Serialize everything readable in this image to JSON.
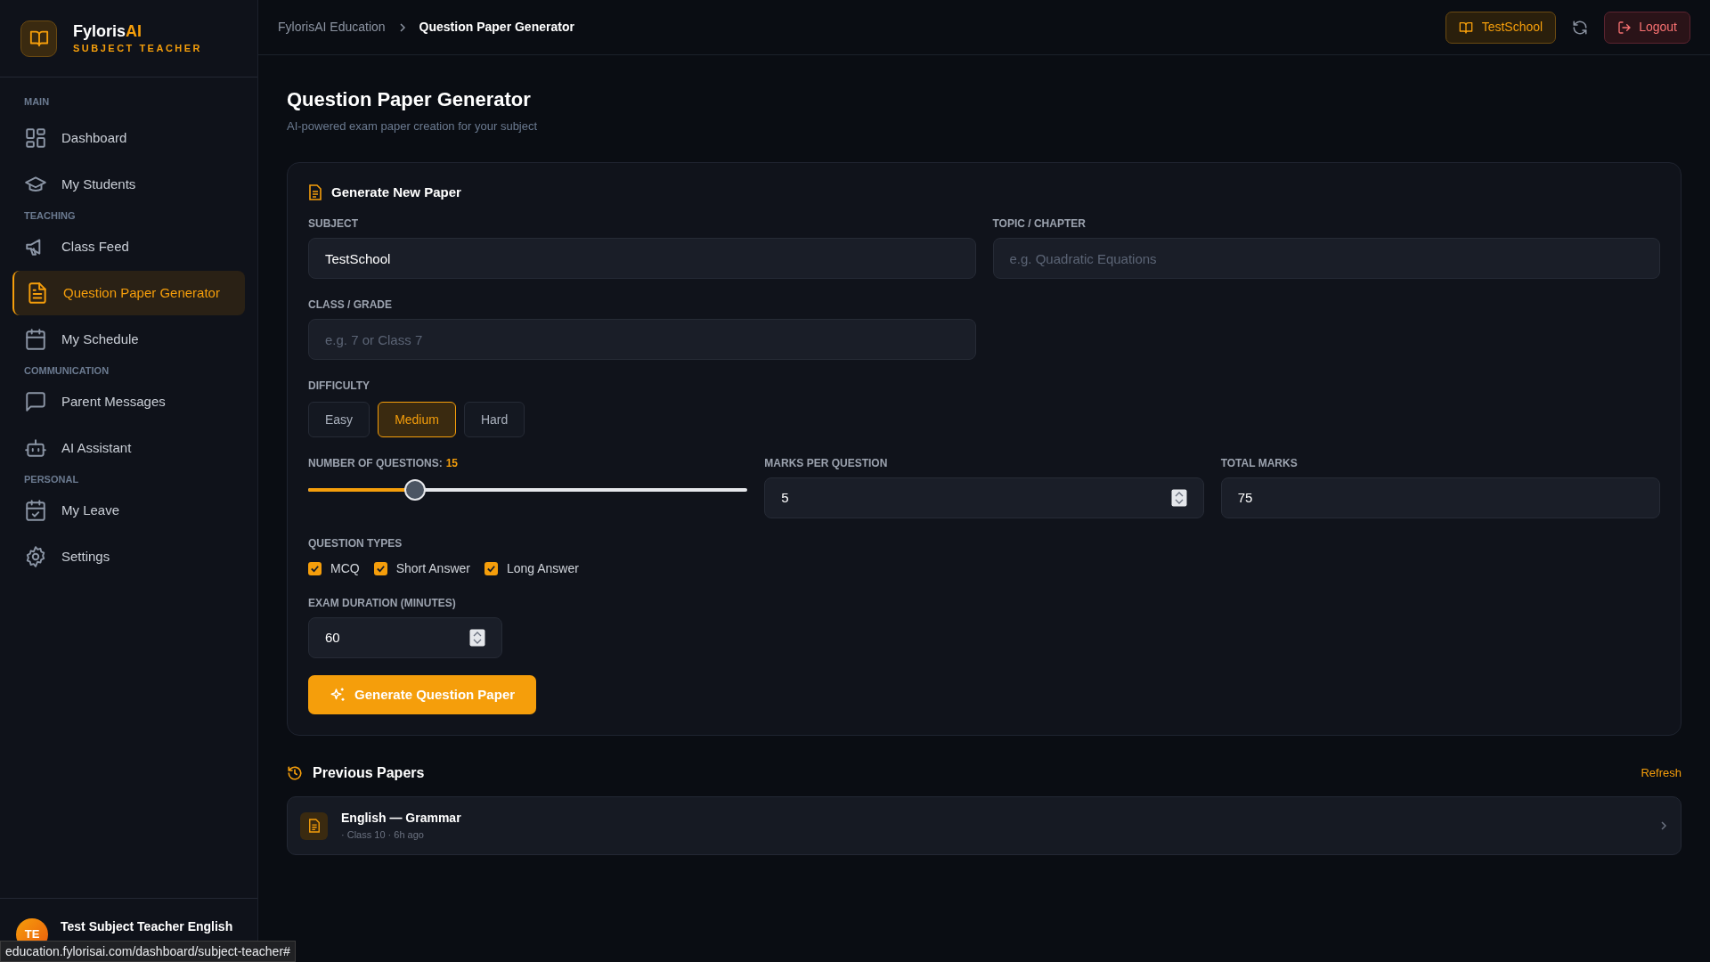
{
  "sidebar": {
    "brand": {
      "name": "Fyloris",
      "name_accent": "AI",
      "role": "SUBJECT TEACHER"
    },
    "sections": [
      {
        "label": "MAIN",
        "items": [
          {
            "label": "Dashboard",
            "selected": false
          },
          {
            "label": "My Students",
            "selected": false
          }
        ]
      },
      {
        "label": "TEACHING",
        "items": [
          {
            "label": "Class Feed",
            "selected": false
          },
          {
            "label": "Question Paper Generator",
            "selected": true
          },
          {
            "label": "My Schedule",
            "selected": false
          }
        ]
      },
      {
        "label": "COMMUNICATION",
        "items": [
          {
            "label": "Parent Messages",
            "selected": false
          },
          {
            "label": "AI Assistant",
            "selected": false
          }
        ]
      },
      {
        "label": "PERSONAL",
        "items": [
          {
            "label": "My Leave",
            "selected": false
          },
          {
            "label": "Settings",
            "selected": false
          }
        ]
      }
    ],
    "user": {
      "initials": "TE",
      "name": "Test Subject Teacher English"
    }
  },
  "header": {
    "breadcrumb": [
      "FylorisAI Education",
      "Question Paper Generator"
    ],
    "school_button": "TestSchool",
    "logout_button": "Logout"
  },
  "page": {
    "title": "Question Paper Generator",
    "subtitle": "AI-powered exam paper creation for your subject"
  },
  "form": {
    "title": "Generate New Paper",
    "subject": {
      "label": "SUBJECT",
      "value": "TestSchool"
    },
    "topic": {
      "label": "TOPIC / CHAPTER",
      "placeholder": "e.g. Quadratic Equations"
    },
    "grade": {
      "label": "CLASS / GRADE",
      "placeholder": "e.g. 7 or Class 7"
    },
    "difficulty": {
      "label": "DIFFICULTY",
      "options": [
        {
          "label": "Easy",
          "selected": false
        },
        {
          "label": "Medium",
          "selected": true
        },
        {
          "label": "Hard",
          "selected": false
        }
      ]
    },
    "questions": {
      "label": "NUMBER OF QUESTIONS:",
      "value": "15",
      "level": 0.23
    },
    "marks_per_question": {
      "label": "MARKS PER QUESTION",
      "value": "5"
    },
    "total_marks": {
      "label": "TOTAL MARKS",
      "value": "75"
    },
    "question_types": {
      "label": "QUESTION TYPES",
      "options": [
        {
          "label": "MCQ",
          "checked": true
        },
        {
          "label": "Short Answer",
          "checked": true
        },
        {
          "label": "Long Answer",
          "checked": true
        }
      ]
    },
    "duration": {
      "label": "EXAM DURATION (MINUTES)",
      "value": "60"
    },
    "submit": "Generate Question Paper"
  },
  "previous_papers": {
    "title": "Previous Papers",
    "refresh": "Refresh",
    "items": [
      {
        "title": "English — Grammar",
        "meta": "· Class 10 · 6h ago"
      }
    ]
  },
  "status_url": "education.fylorisai.com/dashboard/subject-teacher#"
}
